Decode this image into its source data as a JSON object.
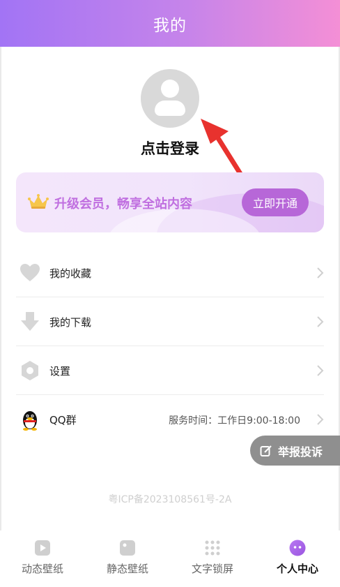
{
  "header": {
    "title": "我的"
  },
  "profile": {
    "login_label": "点击登录"
  },
  "vip": {
    "text": "升级会员，畅享全站内容",
    "button_label": "立即开通"
  },
  "menu": {
    "items": [
      {
        "label": "我的收藏",
        "icon": "heart-icon"
      },
      {
        "label": "我的下载",
        "icon": "download-icon"
      },
      {
        "label": "设置",
        "icon": "settings-icon"
      },
      {
        "label": "QQ群",
        "icon": "qq-penguin-icon",
        "extra": "服务时间：工作日9:00-18:00"
      }
    ]
  },
  "report": {
    "label": "举报投诉",
    "icon": "edit-icon"
  },
  "footer": {
    "icp": "粤ICP备2023108561号-2A"
  },
  "tabs": [
    {
      "label": "动态壁纸",
      "icon": "play-icon"
    },
    {
      "label": "静态壁纸",
      "icon": "image-icon"
    },
    {
      "label": "文字锁屏",
      "icon": "dots-grid-icon"
    },
    {
      "label": "个人中心",
      "icon": "profile-face-icon",
      "active": true
    }
  ],
  "colors": {
    "accent": "#b767d8",
    "header_start": "#a274f5",
    "header_end": "#f48fd6",
    "arrow": "#e8322e"
  }
}
